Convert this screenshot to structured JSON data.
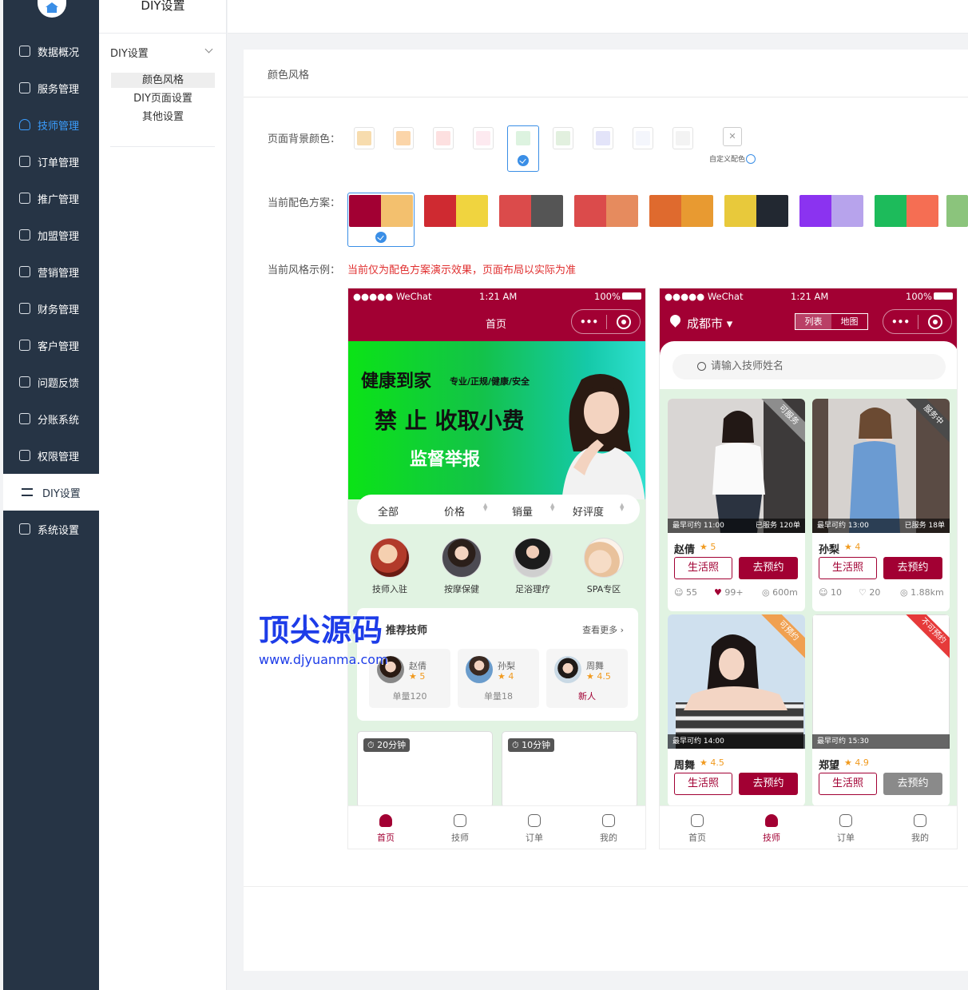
{
  "sidebar": {
    "items": [
      {
        "label": "数据概况",
        "icon": "dashboard-icon"
      },
      {
        "label": "服务管理",
        "icon": "service-icon"
      },
      {
        "label": "技师管理",
        "icon": "technician-icon"
      },
      {
        "label": "订单管理",
        "icon": "order-icon"
      },
      {
        "label": "推广管理",
        "icon": "promotion-icon"
      },
      {
        "label": "加盟管理",
        "icon": "franchise-icon"
      },
      {
        "label": "营销管理",
        "icon": "marketing-icon"
      },
      {
        "label": "财务管理",
        "icon": "finance-icon"
      },
      {
        "label": "客户管理",
        "icon": "customer-icon"
      },
      {
        "label": "问题反馈",
        "icon": "feedback-icon"
      },
      {
        "label": "分账系统",
        "icon": "split-account-icon"
      },
      {
        "label": "权限管理",
        "icon": "permission-icon"
      },
      {
        "label": "DIY设置",
        "icon": "diy-icon"
      },
      {
        "label": "系统设置",
        "icon": "settings-icon"
      }
    ]
  },
  "submenu": {
    "title": "DIY设置",
    "group": "DIY设置",
    "links": [
      "颜色风格",
      "DIY页面设置",
      "其他设置"
    ]
  },
  "panel": {
    "title": "颜色风格",
    "bg_label": "页面背景颜色：",
    "scheme_label": "当前配色方案：",
    "example_label": "当前风格示例：",
    "note": "当前仅为配色方案演示效果，页面布局以实际为准",
    "custom_label": "自定义配色",
    "bg_colors": [
      "#f7dcae",
      "#fbd5a9",
      "#fde0e0",
      "#fdeaf0",
      "#ddf3e0",
      "#e2f0df",
      "#e3e4f9",
      "#f4f6fc",
      "#f3f3f3"
    ],
    "selected_bg": 4,
    "schemes": [
      [
        "#a20033",
        "#f3c06e"
      ],
      [
        "#cf2a31",
        "#f0d43f"
      ],
      [
        "#db4b4b",
        "#555555"
      ],
      [
        "#db4b4b",
        "#e68b5e"
      ],
      [
        "#df6a2e",
        "#e89a31"
      ],
      [
        "#e8c93b",
        "#222831"
      ],
      [
        "#8b33f0",
        "#b7a3ec"
      ],
      [
        "#1dbb5b",
        "#f56e53"
      ],
      [
        "#8bc47c",
        "#8bc47c"
      ]
    ],
    "selected_scheme": 0
  },
  "phone1": {
    "status": {
      "carrier": "●●●●● WeChat",
      "time": "1:21 AM",
      "battery": "100%"
    },
    "title": "首页",
    "banner": {
      "line1": "健康到家",
      "line1_small": "专业/正规/健康/安全",
      "line2": "禁 止  收取小费",
      "line3": "监督举报"
    },
    "sort": [
      "全部",
      "价格",
      "销量",
      "好评度"
    ],
    "categories": [
      "技师入驻",
      "按摩保健",
      "足浴理疗",
      "SPA专区"
    ],
    "recommend_title": "推荐技师",
    "recommend_more": "查看更多",
    "techs": [
      {
        "name": "赵倩",
        "rating": "5",
        "orders": "单量120"
      },
      {
        "name": "孙梨",
        "rating": "4",
        "orders": "单量18"
      },
      {
        "name": "周舞",
        "rating": "4.5",
        "orders": "新人"
      }
    ],
    "timers": [
      "20分钟",
      "10分钟"
    ],
    "tabs": [
      "首页",
      "技师",
      "订单",
      "我的"
    ]
  },
  "phone2": {
    "status": {
      "carrier": "●●●●● WeChat",
      "time": "1:21 AM",
      "battery": "100%"
    },
    "city": "成都市",
    "seg": [
      "列表",
      "地图"
    ],
    "search_placeholder": "请输入技师姓名",
    "cards": [
      {
        "name": "赵倩",
        "rating": "5",
        "badge": "可服务",
        "earliest": "最早可约 11:00",
        "served": "已服务 120单",
        "comments": "55",
        "likes": "99+",
        "distance": "600m",
        "btn_photo": "生活照",
        "btn_book": "去预约"
      },
      {
        "name": "孙梨",
        "rating": "4",
        "badge": "服务中",
        "earliest": "最早可约 13:00",
        "served": "已服务 18单",
        "comments": "10",
        "likes": "20",
        "distance": "1.88km",
        "btn_photo": "生活照",
        "btn_book": "去预约"
      },
      {
        "name": "周舞",
        "rating": "4.5",
        "badge": "可预约",
        "earliest": "最早可约 14:00",
        "btn_photo": "生活照",
        "btn_book": "去预约"
      },
      {
        "name": "郑望",
        "rating": "4.9",
        "badge": "不可预约",
        "earliest": "最早可约 15:30",
        "btn_photo": "生活照",
        "btn_book": "去预约"
      }
    ],
    "tabs": [
      "首页",
      "技师",
      "订单",
      "我的"
    ]
  },
  "watermark": {
    "title": "顶尖源码",
    "url": "www.djyuanma.com"
  }
}
